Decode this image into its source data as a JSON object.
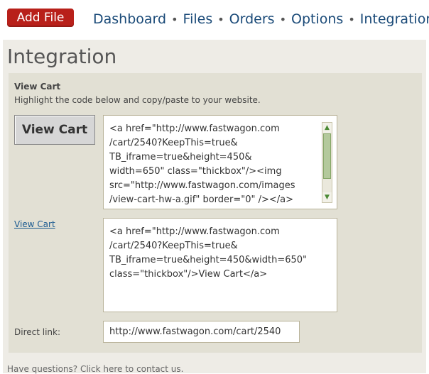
{
  "header": {
    "add_file_label": "Add File",
    "nav": {
      "dashboard": "Dashboard",
      "files": "Files",
      "orders": "Orders",
      "options": "Options",
      "integration": "Integration",
      "separator": "•"
    }
  },
  "page": {
    "title": "Integration"
  },
  "view_cart": {
    "section_title": "View Cart",
    "description": "Highlight the code below and copy/paste to your website.",
    "button_preview_label": "View Cart",
    "button_code_lines": [
      "<a href=\"http://www.fastwagon.com",
      "/cart/2540?KeepThis=true&",
      "TB_iframe=true&height=450&",
      "width=650\" class=\"thickbox\"/><img",
      "src=\"http://www.fastwagon.com/images",
      "/view-cart-hw-a.gif\" border=\"0\" /></a>"
    ],
    "link_preview_label": "View Cart",
    "link_code_lines": [
      "<a href=\"http://www.fastwagon.com",
      "/cart/2540?KeepThis=true&",
      "TB_iframe=true&height=450&width=650\"",
      "class=\"thickbox\"/>View Cart</a>"
    ],
    "direct_link_label": "Direct link:",
    "direct_link_value": "http://www.fastwagon.com/cart/2540"
  },
  "footer_partial": "Have questions? Click here to contact us."
}
